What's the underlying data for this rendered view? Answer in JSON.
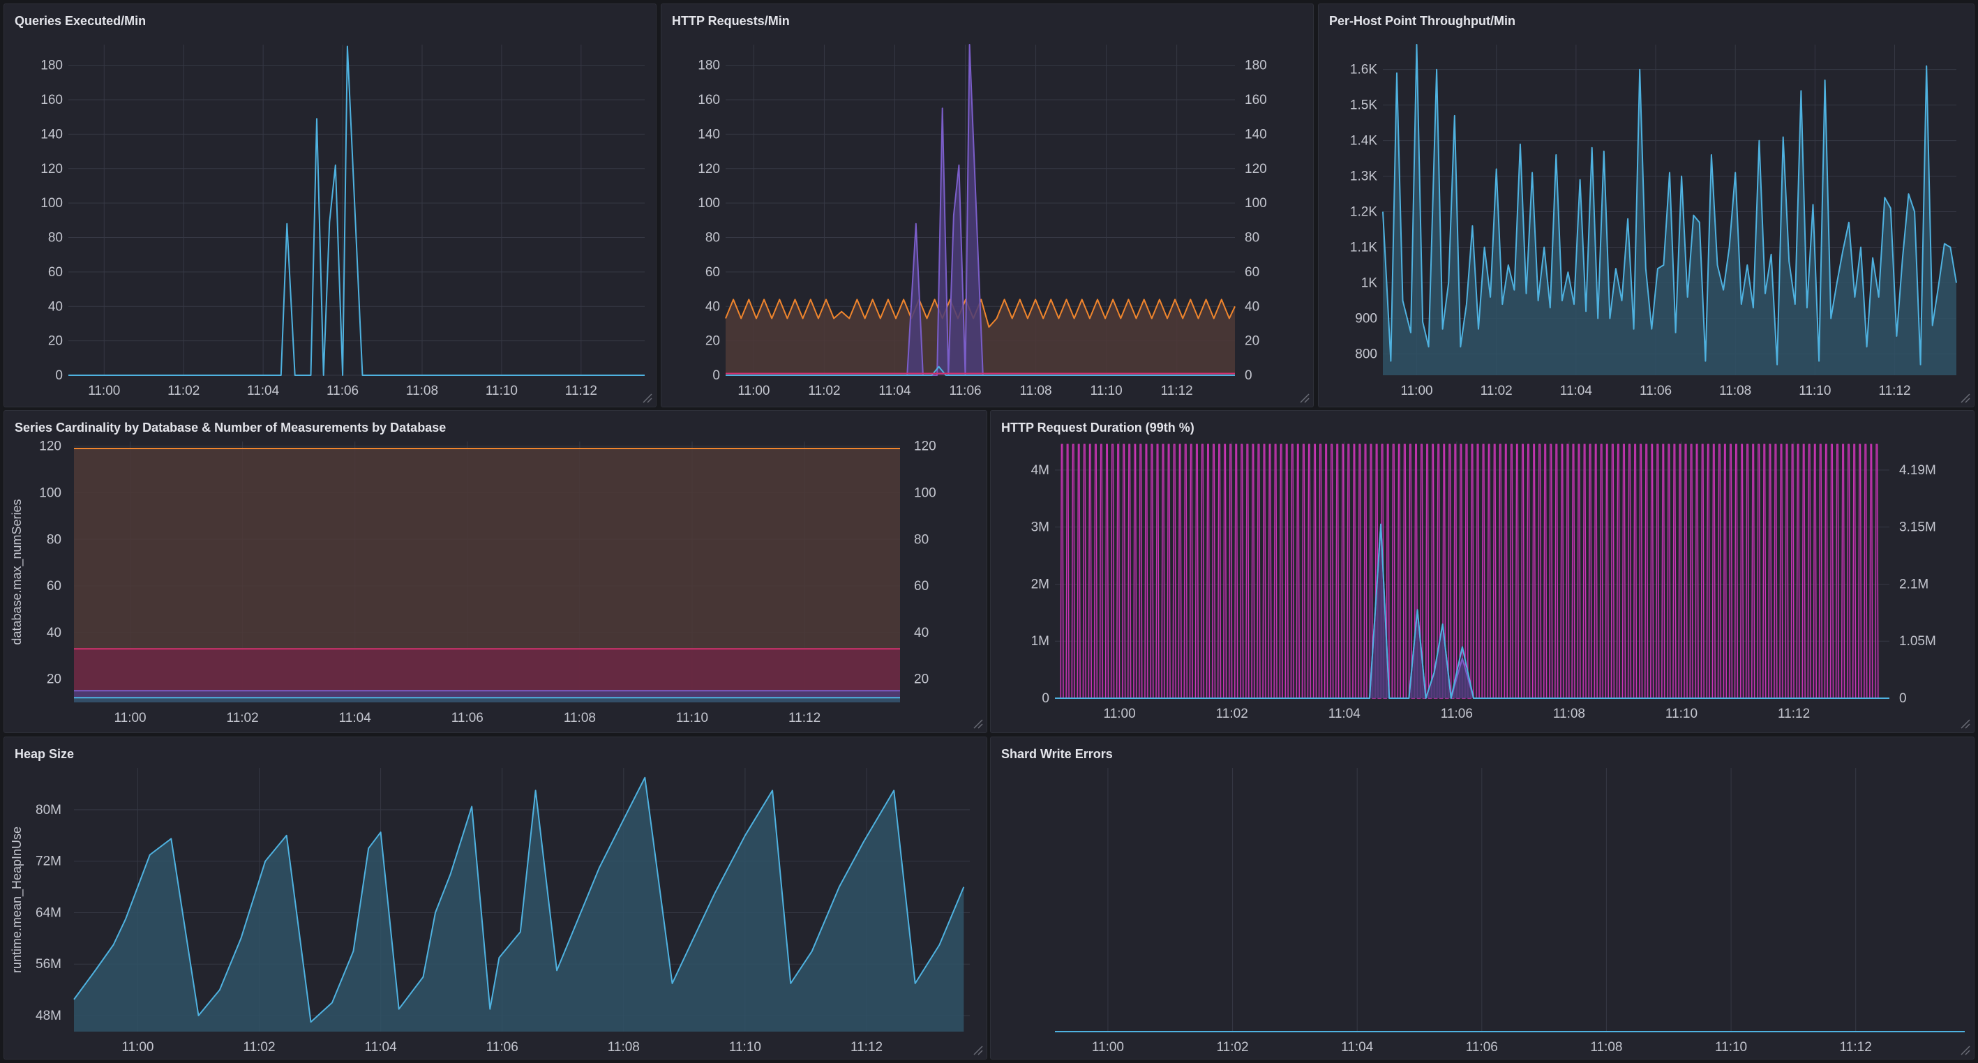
{
  "theme": {
    "grid": "#363844",
    "tick_text": "#c4c6cf",
    "blue": "#4fb2e0",
    "blue_fill": "#2f5266",
    "purple": "#7b5ec9",
    "orange": "#f0852d",
    "orange_fill": "#4e3a37",
    "magenta": "#c935b4",
    "pink": "#d4306e"
  },
  "chart_data": [
    {
      "id": "queries",
      "title": "Queries Executed/Min",
      "type": "area",
      "x_labels": [
        "11:00",
        "11:02",
        "11:04",
        "11:06",
        "11:08",
        "11:10",
        "11:12"
      ],
      "x_label_pos": [
        0.0,
        2.0,
        4.0,
        6.0,
        8.0,
        10.0,
        12.0
      ],
      "xlim": [
        -0.9,
        13.6
      ],
      "y_ticks": [
        0,
        20,
        40,
        60,
        80,
        100,
        120,
        140,
        160,
        180
      ],
      "ylim": [
        0,
        192
      ],
      "series": [
        {
          "color": "blue",
          "fill": false,
          "x": [
            -0.9,
            4.45,
            4.6,
            4.8,
            4.95,
            5.2,
            5.35,
            5.52,
            5.67,
            5.82,
            6.0,
            6.12,
            6.5,
            13.6
          ],
          "y": [
            0,
            0,
            88,
            0,
            0,
            0,
            149,
            0,
            89,
            122,
            0,
            191,
            0,
            0
          ]
        }
      ]
    },
    {
      "id": "http",
      "title": "HTTP Requests/Min",
      "type": "area",
      "x_labels": [
        "11:00",
        "11:02",
        "11:04",
        "11:06",
        "11:08",
        "11:10",
        "11:12"
      ],
      "x_label_pos": [
        0.0,
        2.0,
        4.0,
        6.0,
        8.0,
        10.0,
        12.0
      ],
      "xlim": [
        -0.8,
        13.65
      ],
      "y_ticks": [
        0,
        20,
        40,
        60,
        80,
        100,
        120,
        140,
        160,
        180
      ],
      "y_ticks_right": [
        0,
        20,
        40,
        60,
        80,
        100,
        120,
        140,
        160,
        180
      ],
      "ylim": [
        0,
        192
      ],
      "series": [
        {
          "color": "orange",
          "fill": true,
          "x": [
            -0.8,
            -0.58,
            -0.36,
            -0.14,
            0.07,
            0.29,
            0.51,
            0.73,
            0.95,
            1.17,
            1.39,
            1.61,
            1.83,
            2.05,
            2.27,
            2.49,
            2.71,
            2.93,
            3.15,
            3.37,
            3.59,
            3.81,
            4.03,
            4.25,
            4.47,
            4.69,
            4.91,
            5.13,
            5.35,
            5.57,
            5.79,
            6.01,
            6.23,
            6.45,
            6.67,
            6.89,
            7.11,
            7.33,
            7.55,
            7.77,
            7.99,
            8.21,
            8.43,
            8.65,
            8.87,
            9.09,
            9.31,
            9.53,
            9.75,
            9.97,
            10.19,
            10.41,
            10.63,
            10.85,
            11.07,
            11.29,
            11.51,
            11.73,
            11.95,
            12.17,
            12.39,
            12.61,
            12.83,
            13.05,
            13.27,
            13.49,
            13.65
          ],
          "y": [
            33,
            44,
            33,
            44,
            33,
            44,
            33,
            44,
            33,
            44,
            33,
            44,
            33,
            44,
            33,
            37,
            33,
            44,
            33,
            44,
            33,
            44,
            33,
            44,
            33,
            44,
            33,
            44,
            33,
            44,
            33,
            44,
            33,
            44,
            28,
            33,
            44,
            33,
            44,
            33,
            44,
            33,
            44,
            33,
            44,
            33,
            44,
            33,
            44,
            33,
            44,
            33,
            44,
            33,
            44,
            33,
            44,
            33,
            44,
            33,
            44,
            33,
            44,
            33,
            44,
            33,
            40
          ]
        },
        {
          "color": "purple",
          "fill": true,
          "x": [
            -0.8,
            4.35,
            4.6,
            4.8,
            4.95,
            5.2,
            5.35,
            5.52,
            5.67,
            5.82,
            6.0,
            6.12,
            6.5,
            13.65
          ],
          "y": [
            0,
            0,
            88,
            0,
            0,
            0,
            155,
            0,
            93,
            122,
            0,
            192,
            0,
            0
          ]
        },
        {
          "color": "blue",
          "fill": false,
          "x": [
            -0.8,
            5.05,
            5.25,
            5.45,
            13.65
          ],
          "y": [
            0,
            0,
            5,
            0,
            0
          ]
        },
        {
          "color": "pink",
          "fill": false,
          "x": [
            -0.8,
            13.65
          ],
          "y": [
            1,
            1
          ]
        }
      ]
    },
    {
      "id": "perhost",
      "title": "Per-Host Point Throughput/Min",
      "type": "area",
      "x_labels": [
        "11:00",
        "11:02",
        "11:04",
        "11:06",
        "11:08",
        "11:10",
        "11:12"
      ],
      "x_label_pos": [
        0.0,
        2.0,
        4.0,
        6.0,
        8.0,
        10.0,
        12.0
      ],
      "xlim": [
        -0.85,
        13.55
      ],
      "y_ticks": [
        800,
        900,
        1000,
        1100,
        1200,
        1300,
        1400,
        1500,
        1600
      ],
      "y_tick_labels": [
        "800",
        "900",
        "1K",
        "1.1K",
        "1.2K",
        "1.3K",
        "1.4K",
        "1.5K",
        "1.6K"
      ],
      "ylim": [
        740,
        1670
      ],
      "series": [
        {
          "color": "blue",
          "fill": true,
          "x": [
            -0.85,
            -0.65,
            -0.5,
            -0.35,
            -0.15,
            0.0,
            0.15,
            0.3,
            0.5,
            0.65,
            0.8,
            0.95,
            1.1,
            1.25,
            1.4,
            1.55,
            1.7,
            1.85,
            2.0,
            2.15,
            2.3,
            2.45,
            2.6,
            2.75,
            2.9,
            3.05,
            3.2,
            3.35,
            3.5,
            3.65,
            3.8,
            3.95,
            4.1,
            4.25,
            4.4,
            4.55,
            4.7,
            4.85,
            5.0,
            5.15,
            5.3,
            5.45,
            5.6,
            5.75,
            5.9,
            6.05,
            6.2,
            6.35,
            6.5,
            6.65,
            6.8,
            6.95,
            7.1,
            7.25,
            7.4,
            7.55,
            7.7,
            7.85,
            8.0,
            8.15,
            8.3,
            8.45,
            8.6,
            8.75,
            8.9,
            9.05,
            9.2,
            9.35,
            9.5,
            9.65,
            9.8,
            9.95,
            10.1,
            10.25,
            10.4,
            10.55,
            10.7,
            10.85,
            11.0,
            11.15,
            11.3,
            11.45,
            11.6,
            11.75,
            11.9,
            12.05,
            12.2,
            12.35,
            12.5,
            12.65,
            12.8,
            12.95,
            13.1,
            13.25,
            13.4,
            13.55
          ],
          "y": [
            1200,
            780,
            1590,
            950,
            860,
            1670,
            890,
            820,
            1600,
            870,
            1000,
            1470,
            820,
            940,
            1160,
            870,
            1100,
            960,
            1320,
            940,
            1050,
            980,
            1390,
            970,
            1310,
            950,
            1100,
            930,
            1360,
            950,
            1030,
            940,
            1290,
            920,
            1380,
            900,
            1370,
            900,
            1040,
            950,
            1180,
            870,
            1600,
            1040,
            870,
            1040,
            1050,
            1310,
            860,
            1300,
            960,
            1190,
            1170,
            780,
            1360,
            1050,
            980,
            1100,
            1310,
            940,
            1050,
            930,
            1400,
            970,
            1080,
            770,
            1410,
            1060,
            940,
            1540,
            930,
            1220,
            780,
            1570,
            900,
            1000,
            1090,
            1170,
            960,
            1100,
            820,
            1070,
            960,
            1240,
            1210,
            850,
            1070,
            1250,
            1200,
            770,
            1610,
            880,
            990,
            1110,
            1100,
            1000
          ]
        }
      ]
    },
    {
      "id": "cardinality",
      "title": "Series Cardinality by Database & Number of Measurements by Database",
      "type": "area",
      "ylabel": "database.max_numSeries",
      "x_labels": [
        "11:00",
        "11:02",
        "11:04",
        "11:06",
        "11:08",
        "11:10",
        "11:12"
      ],
      "x_label_pos": [
        0.0,
        2.0,
        4.0,
        6.0,
        8.0,
        10.0,
        12.0
      ],
      "xlim": [
        -1.0,
        13.7
      ],
      "y_ticks": [
        20,
        40,
        60,
        80,
        100,
        120
      ],
      "y_ticks_right": [
        20,
        40,
        60,
        80,
        100,
        120
      ],
      "ylim": [
        10,
        122
      ],
      "series": [
        {
          "color": "orange",
          "fill": true,
          "x": [
            -1.0,
            13.7
          ],
          "y": [
            119,
            119
          ]
        },
        {
          "color": "pink",
          "fill": true,
          "x": [
            -1.0,
            13.7
          ],
          "y": [
            33,
            33
          ]
        },
        {
          "color": "purple",
          "fill": true,
          "x": [
            -1.0,
            13.7
          ],
          "y": [
            15,
            15
          ]
        },
        {
          "color": "blue",
          "fill": true,
          "x": [
            -1.0,
            13.7
          ],
          "y": [
            12,
            12
          ]
        }
      ]
    },
    {
      "id": "duration",
      "title": "HTTP Request Duration (99th %)",
      "type": "area",
      "x_labels": [
        "11:00",
        "11:02",
        "11:04",
        "11:06",
        "11:08",
        "11:10",
        "11:12"
      ],
      "x_label_pos": [
        0.0,
        2.0,
        4.0,
        6.0,
        8.0,
        10.0,
        12.0
      ],
      "xlim": [
        -1.15,
        13.7
      ],
      "y_ticks": [
        0,
        1000000,
        2000000,
        3000000,
        4000000
      ],
      "y_tick_labels": [
        "0",
        "1M",
        "2M",
        "3M",
        "4M"
      ],
      "y_ticks_right": [
        0,
        1050000,
        2100000,
        3150000,
        4190000
      ],
      "y_tick_labels_right": [
        "0",
        "1.05M",
        "2.1M",
        "3.15M",
        "4.19M"
      ],
      "ylim": [
        0,
        4500000
      ],
      "magenta_spikes": {
        "color": "magenta",
        "x_start": -1.05,
        "x_end": 13.45,
        "step": 0.1,
        "peak": 4450000
      },
      "series": [
        {
          "color": "purple",
          "fill": true,
          "x": [
            -1.15,
            4.45,
            4.65,
            4.8,
            4.95,
            5.15,
            5.3,
            5.45,
            5.6,
            5.75,
            5.9,
            6.1,
            6.3,
            13.7
          ],
          "y": [
            0,
            0,
            3050000,
            0,
            0,
            0,
            1550000,
            0,
            450000,
            1300000,
            0,
            700000,
            0,
            0
          ]
        },
        {
          "color": "blue",
          "fill": false,
          "x": [
            -1.15,
            4.45,
            4.65,
            4.8,
            4.95,
            5.15,
            5.3,
            5.45,
            5.6,
            5.75,
            5.9,
            6.1,
            6.3,
            13.7
          ],
          "y": [
            0,
            0,
            3050000,
            0,
            0,
            0,
            1550000,
            0,
            450000,
            1300000,
            0,
            900000,
            0,
            0
          ]
        }
      ]
    },
    {
      "id": "heap",
      "title": "Heap Size",
      "type": "area",
      "ylabel": "runtime.mean_HeapInUse",
      "x_labels": [
        "11:00",
        "11:02",
        "11:04",
        "11:06",
        "11:08",
        "11:10",
        "11:12"
      ],
      "x_label_pos": [
        0.0,
        2.0,
        4.0,
        6.0,
        8.0,
        10.0,
        12.0
      ],
      "xlim": [
        -1.05,
        13.7
      ],
      "y_ticks": [
        48000000,
        56000000,
        64000000,
        72000000,
        80000000
      ],
      "y_tick_labels": [
        "48M",
        "56M",
        "64M",
        "72M",
        "80M"
      ],
      "ylim": [
        45500000,
        86500000
      ],
      "series": [
        {
          "color": "blue",
          "fill": true,
          "x": [
            -1.05,
            -0.7,
            -0.4,
            -0.2,
            0.2,
            0.55,
            1.0,
            1.35,
            1.7,
            2.1,
            2.45,
            2.85,
            3.2,
            3.55,
            3.8,
            4.0,
            4.3,
            4.7,
            4.9,
            5.15,
            5.5,
            5.8,
            5.95,
            6.3,
            6.55,
            6.9,
            7.25,
            7.6,
            8.0,
            8.35,
            8.8,
            9.15,
            9.5,
            10.0,
            10.45,
            10.75,
            11.1,
            11.55,
            11.95,
            12.45,
            12.8,
            13.2,
            13.6
          ],
          "y": [
            50500000,
            55000000,
            59000000,
            63000000,
            73000000,
            75500000,
            48000000,
            52000000,
            60000000,
            72000000,
            76000000,
            47000000,
            50000000,
            58000000,
            74000000,
            76500000,
            49000000,
            54000000,
            64000000,
            70000000,
            80500000,
            49000000,
            57000000,
            61000000,
            83000000,
            55000000,
            63000000,
            71000000,
            78500000,
            85000000,
            53000000,
            60000000,
            67000000,
            76000000,
            83000000,
            53000000,
            58000000,
            68000000,
            75000000,
            83000000,
            53000000,
            59000000,
            68000000
          ]
        }
      ]
    },
    {
      "id": "shard",
      "title": "Shard Write Errors",
      "type": "line",
      "x_labels": [
        "11:00",
        "11:02",
        "11:04",
        "11:06",
        "11:08",
        "11:10",
        "11:12"
      ],
      "x_label_pos": [
        0.0,
        2.0,
        4.0,
        6.0,
        8.0,
        10.0,
        12.0
      ],
      "xlim": [
        -0.85,
        13.75
      ],
      "y_ticks": [],
      "ylim": [
        0,
        1
      ],
      "series": [
        {
          "color": "blue",
          "fill": false,
          "x": [
            -0.85,
            13.75
          ],
          "y": [
            0,
            0
          ]
        }
      ]
    }
  ]
}
